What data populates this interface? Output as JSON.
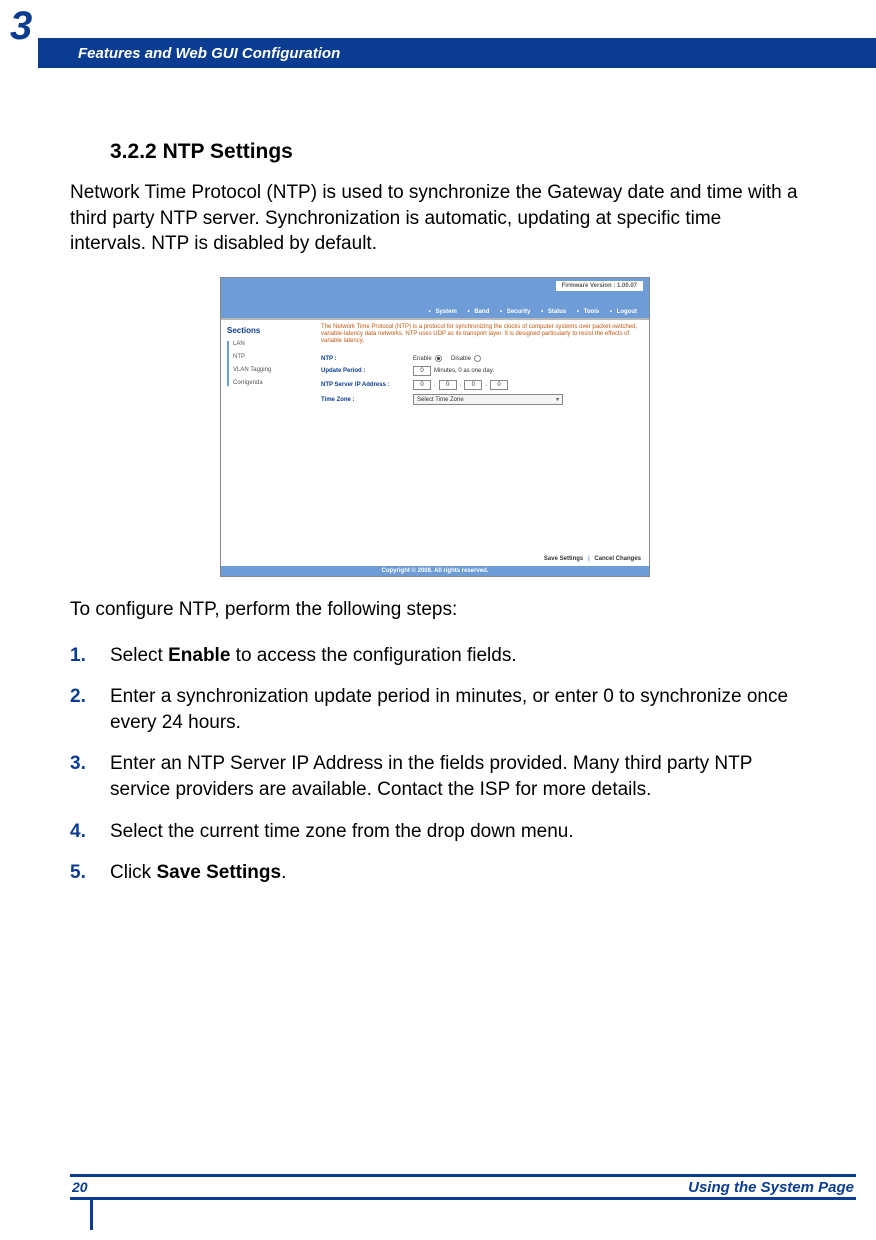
{
  "header": {
    "chapter_number": "3",
    "title": "Features and Web GUI Configuration"
  },
  "section": {
    "number": "3.2.2",
    "title": "NTP Settings",
    "intro": "Network Time Protocol (NTP) is used to synchronize the Gateway date and time with a third party NTP server. Synchronization is automatic, updating at specific time intervals. NTP is disabled by default.",
    "config_lead": "To configure NTP, perform the following steps:",
    "steps": [
      {
        "pre": "Select ",
        "bold": "Enable",
        "post": " to access the configuration fields."
      },
      {
        "pre": "Enter a synchronization update period in minutes, or enter 0 to synchronize once every 24 hours.",
        "bold": "",
        "post": ""
      },
      {
        "pre": "Enter an NTP Server IP Address in the fields provided. Many third party NTP service providers are available. Contact the ISP for more details.",
        "bold": "",
        "post": ""
      },
      {
        "pre": "Select the current time zone from the drop down menu.",
        "bold": "",
        "post": ""
      },
      {
        "pre": "Click ",
        "bold": "Save Settings",
        "post": "."
      }
    ]
  },
  "screenshot": {
    "firmware_label": "Firmware Version : 1.00.07",
    "nav": [
      "System",
      "Band",
      "Security",
      "Status",
      "Tools",
      "Logout"
    ],
    "sections_label": "Sections",
    "menu": [
      "LAN",
      "NTP",
      "VLAN Tagging",
      "Corrigenda"
    ],
    "description": "The Network Time Protocol (NTP) is a protocol for synchronizing the clocks of computer systems over packet-switched, variable-latency data networks. NTP uses UDP as its transport layer. It is designed particularly to resist the effects of variable latency.",
    "fields": {
      "ntp_label": "NTP :",
      "enable_label": "Enable",
      "disable_label": "Disable",
      "update_label": "Update Period :",
      "update_value": "0",
      "update_suffix": "Minutes, 0 as one day.",
      "server_label": "NTP Server IP Address :",
      "server_values": [
        "0",
        "0",
        "0",
        "0"
      ],
      "tz_label": "Time Zone :",
      "tz_value": "Select Time Zone"
    },
    "save_label": "Save Settings",
    "cancel_label": "Cancel Changes",
    "copyright": "Copyright © 2008.  All rights reserved."
  },
  "footer": {
    "page": "20",
    "section": "Using the System Page"
  }
}
